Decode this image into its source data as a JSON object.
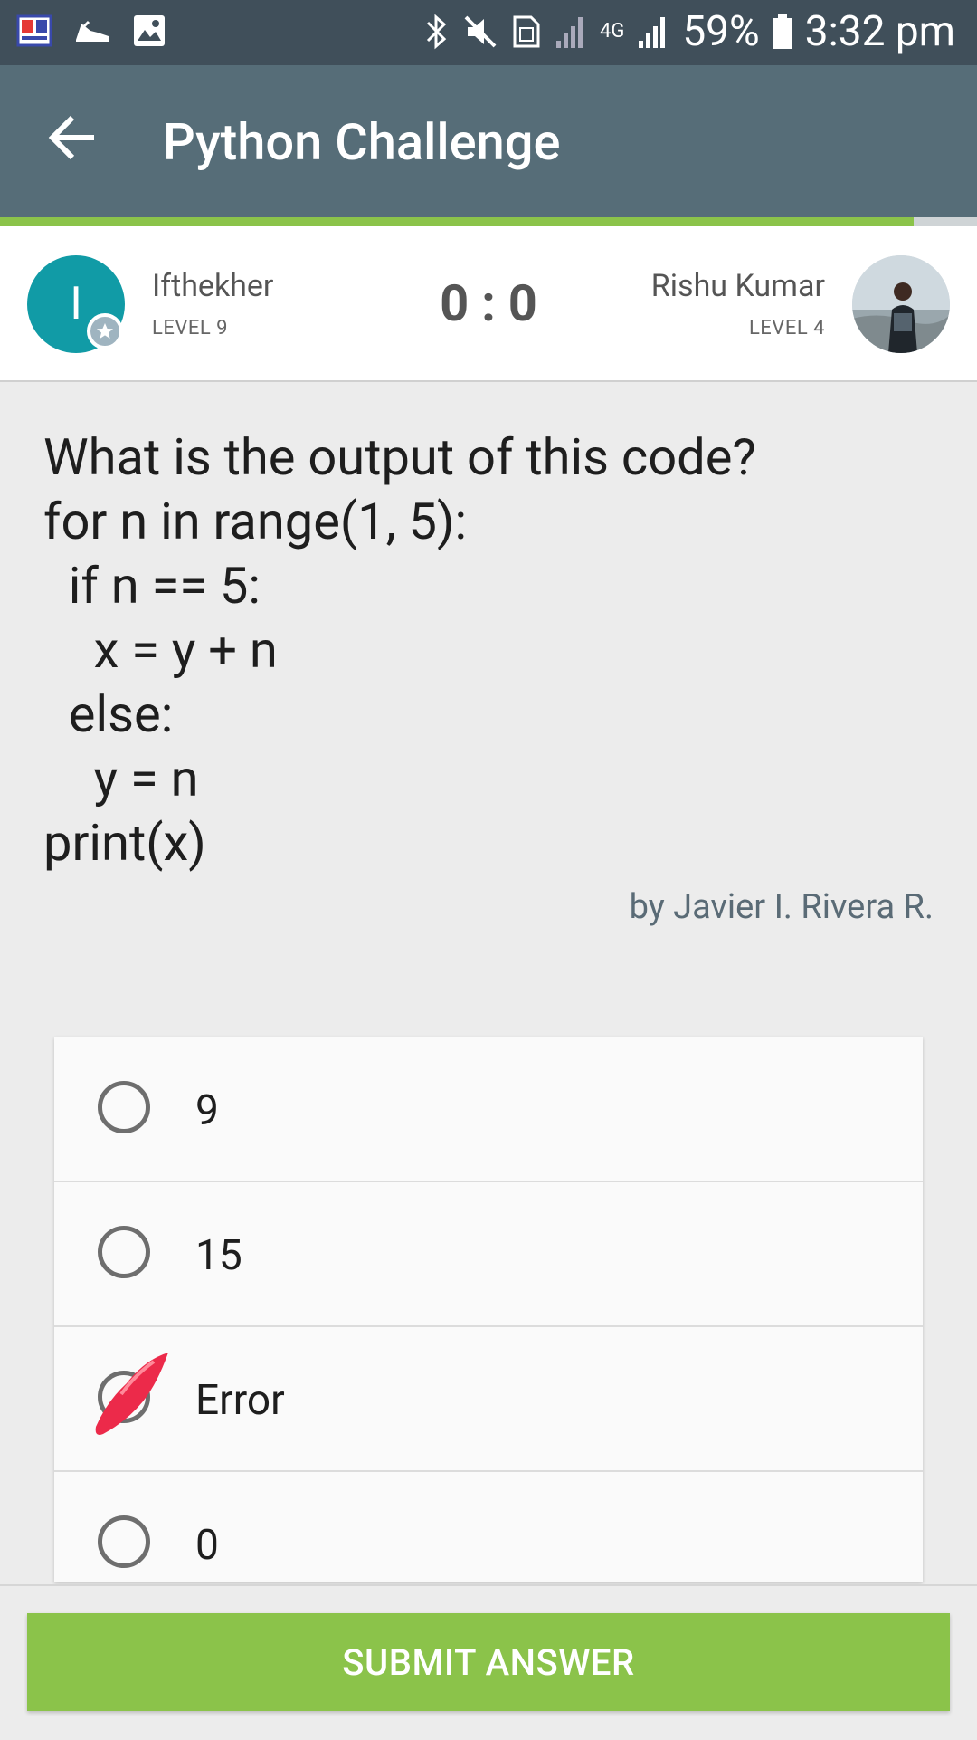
{
  "status_bar": {
    "battery": "59%",
    "time": "3:32 pm",
    "network": "4G",
    "left_icons": [
      "news-app-icon",
      "running-shoe-icon",
      "image-icon"
    ],
    "right_icons": [
      "bluetooth-icon",
      "mute-icon",
      "sim-icon",
      "signal-icon",
      "signal-icon",
      "battery-icon"
    ]
  },
  "app_bar": {
    "title": "Python Challenge",
    "back_icon": "arrow-left-icon",
    "background": "#566d78"
  },
  "progress": {
    "fraction": 0.935,
    "color": "#8bc34a"
  },
  "players": {
    "left": {
      "initial": "I",
      "name": "Ifthekher",
      "level": "LEVEL 9",
      "avatar_color": "#119ba6"
    },
    "right": {
      "name": "Rishu Kumar",
      "level": "LEVEL 4"
    },
    "score": "0 : 0"
  },
  "question": {
    "lines": [
      "What is the output of this code?",
      "for n in range(1, 5):",
      "  if n == 5:",
      "    x = y + n",
      "  else:",
      "    y = n",
      "print(x)"
    ],
    "author": "by Javier I. Rivera R."
  },
  "options": [
    {
      "label": "9",
      "state": "unselected"
    },
    {
      "label": "15",
      "state": "unselected"
    },
    {
      "label": "Error",
      "state": "eliminated"
    },
    {
      "label": "0",
      "state": "unselected"
    }
  ],
  "submit": {
    "label": "SUBMIT ANSWER",
    "color": "#8bc34a"
  }
}
